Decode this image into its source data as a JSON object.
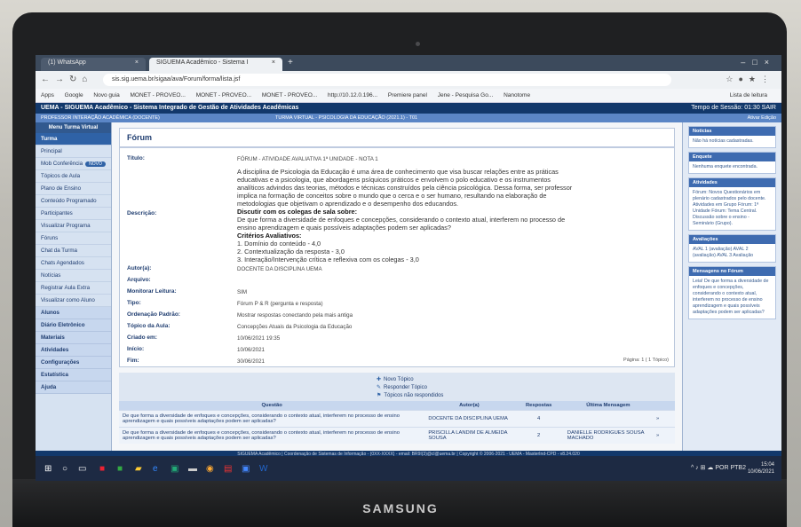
{
  "device": {
    "brand": "SAMSUNG"
  },
  "browser": {
    "tabs": [
      {
        "label": "(1) WhatsApp"
      },
      {
        "label": "SIGUEMA Acadêmico - Sistema I"
      }
    ],
    "url": "sis.sig.uema.br/sigaa/ava/Forum/forma/lista.jsf",
    "bookmarks": [
      "Apps",
      "Google",
      "Novo guia",
      "MONET - PROVEO...",
      "MONET - PROVEO...",
      "MONET - PROVEO...",
      "http://10.12.0.196...",
      "Premiere panel",
      "Jene - Pesquisa Go...",
      "Nanotome"
    ],
    "bookmarks_right": "Lista de leitura"
  },
  "system": {
    "header": "UEMA - SIGUEMA Acadêmico - Sistema Integrado de Gestão de Atividades Acadêmicas",
    "header_right": "Tempo de Sessão: 01:30  SAIR",
    "sub": "PROFESSOR INTERAÇÃO ACADÊMICA (DOCENTE)",
    "sub_course": "TURMA VIRTUAL - PSICOLOGIA DA EDUCAÇÃO (2021.1) - T01",
    "sub_right": "Ativar Edição"
  },
  "sidebar": {
    "title": "Menu Turma Virtual",
    "head": "Turma",
    "items": [
      "Principal",
      "Mob Conferência",
      "Tópicos de Aula",
      "Plano de Ensino",
      "Conteúdo Programado",
      "Participantes",
      "Visualizar Programa",
      "Fóruns",
      "Chat da Turma",
      "Chats Agendados",
      "Notícias",
      "Registrar Aula Extra",
      "Visualizar como Aluno"
    ],
    "badge": "NOVO",
    "groups": [
      "Alunos",
      "Diário Eletrônico",
      "Materiais",
      "Atividades",
      "Configurações",
      "Estatística",
      "Ajuda"
    ]
  },
  "forum": {
    "title": "Fórum",
    "labels": {
      "titulo": "Título:",
      "descricao": "Descrição:",
      "autor": "Autor(a):",
      "arquivo": "Arquivo:",
      "leitura": "Monitorar Leitura:",
      "tipo": "Tipo:",
      "ordenacao": "Ordenação Padrão:",
      "topicos": "Tópico da Aula:",
      "criado": "Criado em:",
      "inicio": "Início:",
      "fim": "Fim:"
    },
    "values": {
      "titulo": "FÓRUM - ATIVIDADE AVALIATIVA 1ª UNIDADE - NOTA 1",
      "desc_p1": "A disciplina de Psicologia da Educação é uma área de conhecimento que visa buscar relações entre as práticas educativas e a psicologia, que abordagens psíquicos práticos e envolvem o polo educativo e os instrumentos analíticos advindos das teorias, métodos e técnicas construídos pela ciência psicológica. Dessa forma, ser professor implica na formação de conceitos sobre o mundo que o cerca e o ser humano, resultando na elaboração de metodologias que objetivam o aprendizado e o desempenho dos educandos.",
      "desc_q_title": "Discutir com os colegas de sala sobre:",
      "desc_q": "De que forma a diversidade de enfoques e concepções, considerando o contexto atual, interferem no processo de ensino aprendizagem e quais possíveis adaptações podem ser aplicadas?",
      "criterios_title": "Critérios Avaliativos:",
      "criterios": [
        "1. Domínio do conteúdo - 4,0",
        "2. Contextualização da resposta - 3,0",
        "3. Interação/Intervenção crítica e reflexiva com os colegas - 3,0"
      ],
      "autor": "DOCENTE DA DISCIPLINA UEMA",
      "arquivo": "",
      "leitura": "SIM",
      "tipo": "Fórum P & R (pergunta e resposta)",
      "ordenacao": "Mostrar respostas conectando pela mais antiga",
      "topicos": "Concepções Atuais da Psicologia da Educação",
      "criado": "10/06/2021 19:35",
      "inicio": "10/06/2021",
      "fim": "30/06/2021"
    },
    "count": "Página: 1 ( 1 Tópico)"
  },
  "actions": [
    "Novo Tópico",
    "Responder Tópico",
    "Tópicos não respondidos"
  ],
  "table": {
    "headers": [
      "Questão",
      "Autor(a)",
      "Respostas",
      "Última Mensagem",
      ""
    ],
    "rows": [
      [
        "De que forma a diversidade de enfoques e concepções, considerando o contexto atual, interferem no processo de ensino aprendizagem e quais possíveis adaptações podem ser aplicadas?",
        "DOCENTE DA DISCIPLINA UEMA",
        "4",
        "",
        "»"
      ],
      [
        "De que forma a diversidade de enfoques e concepções, considerando o contexto atual, interferem no processo de ensino aprendizagem e quais possíveis adaptações podem ser aplicadas?",
        "PRISCILLA LANDIM DE ALMEIDA SOUSA",
        "2",
        "DANIELLE RODRIGUES SOUSA MACHADO",
        "»"
      ]
    ]
  },
  "rightcol": {
    "btn": "Ativar Edição",
    "boxes": [
      {
        "head": "Notícias",
        "body": "Não há notícias cadastradas."
      },
      {
        "head": "Enquete",
        "body": "Nenhuma enquete encontrada."
      },
      {
        "head": "Atividades",
        "body": "Fórum: Novos Questionários em plenário cadastrados pelo docente. Atividades em Grupo Fórum: 1ª Unidade Fórum: Tema Central. Discussão sobre o ensino - Seminário (Grupo)."
      },
      {
        "head": "Avaliações",
        "body": "AVAL 1 (avaliação) AVAL 2 (avaliação) AVAL 3 Avaliação"
      },
      {
        "head": "Mensagens no Fórum",
        "body": "Leia! De que forma a diversidade de enfoques e concepções, considerando o contexto atual, interferem no processo de ensino aprendizagem e quais possíveis adaptações podem ser aplicadas?"
      }
    ]
  },
  "statusline": "SIGUEMA Acadêmico | Coordenação de Sistemas de Informação - (0XX-XXXX) - email: BR9I(3)@cl@uema.br | Copyright © 2006-2021 - UEMA - MasterInd-CPD - v8.24.020",
  "taskbar": {
    "clock_time": "15:04",
    "clock_date": "10/06/2021",
    "lang": "POR PTB2"
  }
}
